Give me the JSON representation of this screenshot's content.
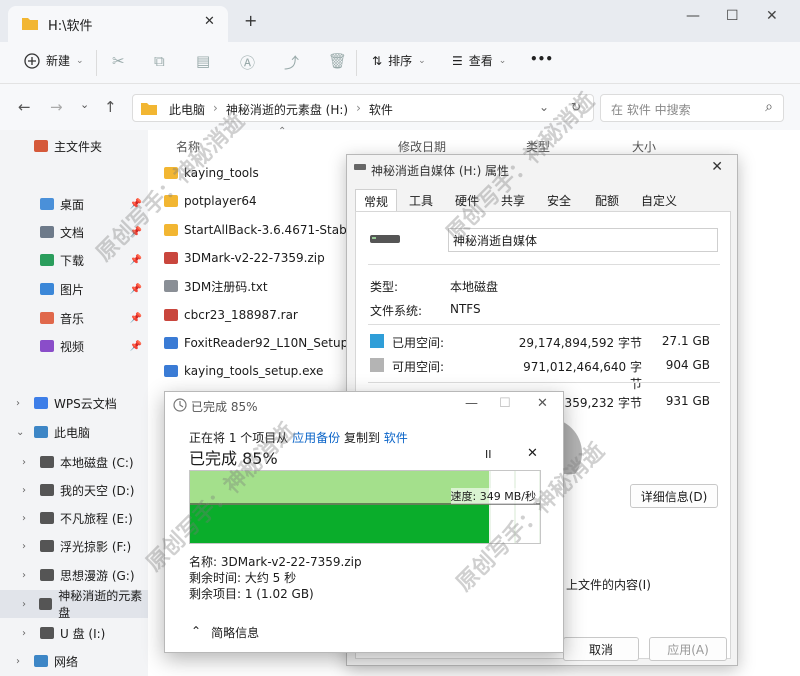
{
  "window": {
    "tab_title": "H:\\软件",
    "new_tab": "+"
  },
  "toolbar": {
    "new_label": "新建",
    "sort_label": "排序",
    "view_label": "查看",
    "more_label": "•••"
  },
  "address": {
    "crumbs": [
      "此电脑",
      "神秘消逝的元素盘 (H:)",
      "软件"
    ]
  },
  "search": {
    "placeholder": "在 软件 中搜索"
  },
  "sidebar": {
    "items": [
      {
        "label": "主文件夹",
        "icon": "home-icon",
        "color": "#d5593a",
        "pinned": false
      },
      {
        "label": "桌面",
        "icon": "desktop-icon",
        "color": "#4a90d9",
        "pinned": true
      },
      {
        "label": "文档",
        "icon": "documents-icon",
        "color": "#6d7a8a",
        "pinned": true
      },
      {
        "label": "下载",
        "icon": "download-icon",
        "color": "#2a9d5c",
        "pinned": true
      },
      {
        "label": "图片",
        "icon": "pictures-icon",
        "color": "#3b87d8",
        "pinned": true
      },
      {
        "label": "音乐",
        "icon": "music-icon",
        "color": "#e0684b",
        "pinned": true
      },
      {
        "label": "视频",
        "icon": "video-icon",
        "color": "#8a4dc9",
        "pinned": true
      },
      {
        "label": "WPS云文档",
        "icon": "cloud-icon",
        "color": "#3d7ee8",
        "pinned": false
      },
      {
        "label": "此电脑",
        "icon": "computer-icon",
        "color": "#3d86c6",
        "pinned": false
      },
      {
        "label": "本地磁盘 (C:)",
        "icon": "drive-icon",
        "color": "#555",
        "pinned": false
      },
      {
        "label": "我的天空 (D:)",
        "icon": "drive-icon",
        "color": "#555",
        "pinned": false
      },
      {
        "label": "不凡旅程 (E:)",
        "icon": "drive-icon",
        "color": "#555",
        "pinned": false
      },
      {
        "label": "浮光掠影 (F:)",
        "icon": "drive-icon",
        "color": "#555",
        "pinned": false
      },
      {
        "label": "思想漫游 (G:)",
        "icon": "drive-icon",
        "color": "#555",
        "pinned": false
      },
      {
        "label": "神秘消逝的元素盘",
        "icon": "drive-icon",
        "color": "#555",
        "pinned": false
      },
      {
        "label": "U 盘 (I:)",
        "icon": "usb-drive-icon",
        "color": "#555",
        "pinned": false
      },
      {
        "label": "网络",
        "icon": "network-icon",
        "color": "#3d86c6",
        "pinned": false
      }
    ]
  },
  "columns": {
    "name": "名称",
    "modified": "修改日期",
    "type": "类型",
    "size": "大小"
  },
  "files": [
    {
      "name": "kaying_tools",
      "kind": "folder"
    },
    {
      "name": "potplayer64",
      "kind": "folder"
    },
    {
      "name": "StartAllBack-3.6.4671-Stable-I",
      "kind": "folder"
    },
    {
      "name": "3DMark-v2-22-7359.zip",
      "kind": "archive"
    },
    {
      "name": "3DM注册码.txt",
      "kind": "text"
    },
    {
      "name": "cbcr23_188987.rar",
      "kind": "archive"
    },
    {
      "name": "FoxitReader92_L10N_Setup.exe",
      "kind": "exe"
    },
    {
      "name": "kaying_tools_setup.exe",
      "kind": "exe"
    }
  ],
  "properties": {
    "title": "神秘消逝自媒体 (H:) 属性",
    "tabs": [
      "常规",
      "工具",
      "硬件",
      "共享",
      "安全",
      "配额",
      "自定义"
    ],
    "volume_name": "神秘消逝自媒体",
    "type_label": "类型:",
    "type_value": "本地磁盘",
    "fs_label": "文件系统:",
    "fs_value": "NTFS",
    "used_label": "已用空间:",
    "used_bytes": "29,174,894,592 字节",
    "used_gb": "27.1 GB",
    "free_label": "可用空间:",
    "free_bytes": "971,012,464,640 字节",
    "free_gb": "904 GB",
    "capacity_bytes": "7,359,232 字节",
    "capacity_gb": "931 GB",
    "details_button": "详细信息(D)",
    "index_text": "上文件的内容(I)",
    "cancel_button": "取消",
    "apply_button": "应用(A)",
    "used_color": "#2f9ed8",
    "free_color": "#b4b4b4"
  },
  "copy": {
    "title": "已完成 85%",
    "line_prefix": "正在将 1 个项目从",
    "source": "应用备份",
    "line_mid": "复制到",
    "dest": "软件",
    "progress_label": "已完成 85%",
    "progress": 0.85,
    "speed": "速度: 349 MB/秒",
    "name_line": "名称: 3DMark-v2-22-7359.zip",
    "remaining_time": "剩余时间: 大约 5 秒",
    "remaining_items": "剩余项目: 1 (1.02 GB)",
    "less_info": "简略信息",
    "pause_glyph": "II",
    "close_glyph": "✕",
    "bar_color": "#0aad2b",
    "bar_light": "#a4e08c"
  },
  "watermark": "原创写手：神秘消逝"
}
